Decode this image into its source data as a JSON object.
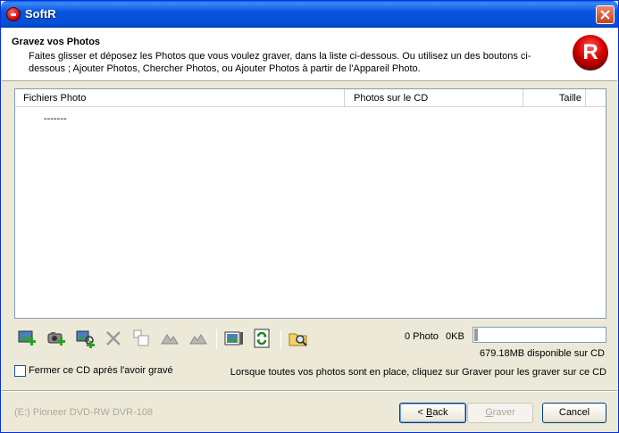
{
  "window": {
    "title": "SoftR"
  },
  "header": {
    "title": "Gravez vos Photos",
    "description": "Faites glisser et déposez les Photos que vous voulez graver, dans la liste ci-dessous. Ou utilisez un des boutons ci-dessous ; Ajouter Photos, Chercher Photos, ou Ajouter Photos à partir de l'Appareil Photo.",
    "logo_letter": "R"
  },
  "list": {
    "columns": [
      "Fichiers Photo",
      "Photos sur le CD",
      "Taille"
    ],
    "rows": [
      "-------"
    ]
  },
  "toolbar": {
    "icons": [
      "add-photo-icon",
      "camera-add-icon",
      "search-photos-icon",
      "delete-icon",
      "copy-icon",
      "rotate-left-icon",
      "rotate-right-icon",
      "slideshow-icon",
      "refresh-icon",
      "explore-folder-icon"
    ]
  },
  "status": {
    "photo_count": "0 Photo",
    "size": "0KB",
    "available": "679.18MB disponible sur CD",
    "capacity_used_fraction": 0.02
  },
  "options": {
    "close_cd_label": "Fermer ce CD après l'avoir gravé",
    "close_cd_checked": false
  },
  "hint": "Lorsque toutes vos photos sont en place, cliquez sur Graver pour les graver sur ce CD",
  "drive": "(E:) Pioneer DVD-RW DVR-108",
  "buttons": {
    "back_accel": "B",
    "back_rest": "ack",
    "burn_accel": "G",
    "burn_rest": "raver",
    "cancel": "Cancel"
  },
  "colors": {
    "titlebar": "#0a54e0",
    "accent_red": "#d40000"
  }
}
